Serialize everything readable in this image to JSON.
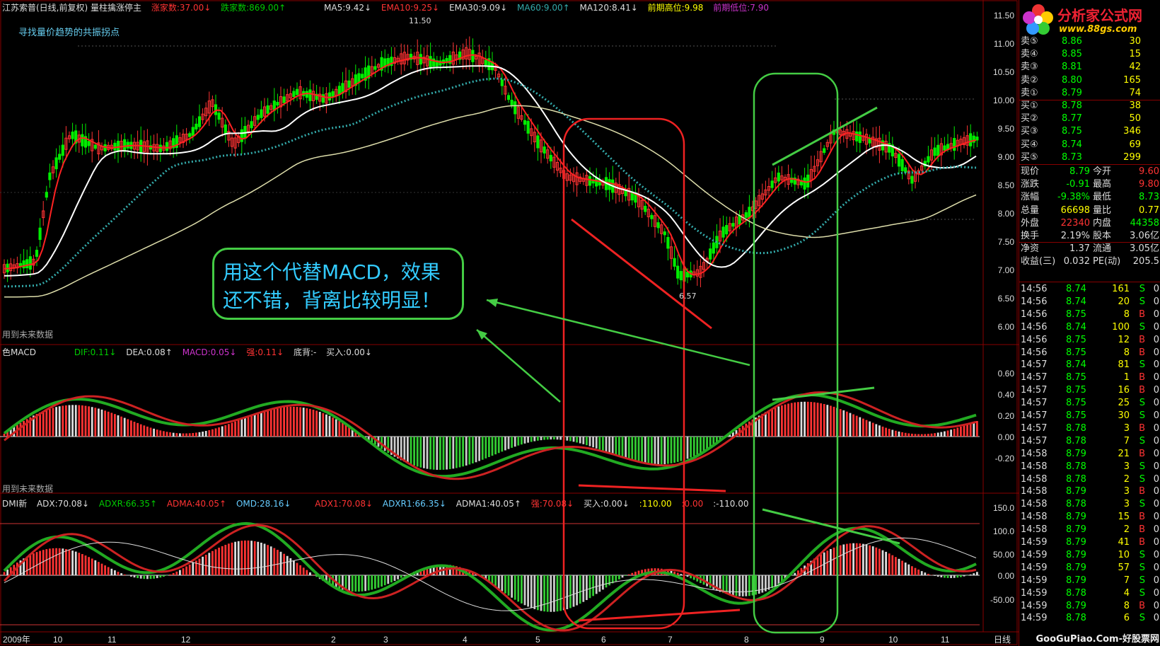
{
  "header": {
    "title": "江苏索普(日线,前复权) 量柱擒涨停主",
    "rise_count": "涨家数:37.00↓",
    "fall_count": "跌家数:869.00↑",
    "ma5": "MA5:9.42↓",
    "ema10": "EMA10:9.25↓",
    "ema30": "EMA30:9.09↓",
    "ma60": "MA60:9.00↑",
    "ma120": "MA120:8.41↓",
    "prev_high": "前期高位:9.98",
    "prev_low": "前期低位:7.90",
    "subtitle": "寻找量价趋势的共振拐点",
    "high_label": "11.50",
    "low_label": "6.57"
  },
  "future_labels": {
    "main": "用到未来数据",
    "macd": "用到未来数据"
  },
  "macd_header": {
    "name": "色MACD",
    "dif": "DIF:0.11↓",
    "dea": "DEA:0.08↑",
    "macd": "MACD:0.05↓",
    "strong": "强:0.11↓",
    "bottom": "底背:-",
    "buy": "买入:0.00↓"
  },
  "dmi_header": {
    "name": "DMI新",
    "adx": "ADX:70.08↓",
    "adxr": "ADXR:66.35↑",
    "adma": "ADMA:40.05↑",
    "omd": "OMD:28.16↓",
    "adx1": "ADX1:70.08↓",
    "adxr1": "ADXR1:66.35↓",
    "adma1": "ADMA1:40.05↑",
    "strong": "强:70.08↓",
    "buy": "买入:0.00↓",
    "v1": ":110.00",
    "v2": ":0.00",
    "v3": ":-110.00"
  },
  "price_axis": [
    "11.50",
    "11.00",
    "10.50",
    "10.00",
    "9.50",
    "9.00",
    "8.50",
    "8.00",
    "7.50",
    "7.00",
    "6.50",
    "6.00"
  ],
  "macd_axis": [
    "0.60",
    "0.40",
    "0.20",
    "0.00",
    "-0.20"
  ],
  "dmi_axis": [
    "150.0",
    "100.0",
    "50.00",
    "0.00",
    "-50.00"
  ],
  "x_axis": [
    "2009年",
    "10",
    "11",
    "12",
    "2",
    "3",
    "4",
    "5",
    "6",
    "7",
    "8",
    "9",
    "10",
    "11",
    "日线"
  ],
  "callout": {
    "line1": "用这个代替MACD，效果",
    "line2": "还不错，背离比较明显！"
  },
  "logo": {
    "brand": "分析家公式网",
    "url": "www.88gs.com"
  },
  "order_book": [
    {
      "label": "卖⑤",
      "price": "8.86",
      "vol": "30"
    },
    {
      "label": "卖④",
      "price": "8.85",
      "vol": "15"
    },
    {
      "label": "卖③",
      "price": "8.81",
      "vol": "42"
    },
    {
      "label": "卖②",
      "price": "8.80",
      "vol": "165"
    },
    {
      "label": "卖①",
      "price": "8.79",
      "vol": "74"
    },
    {
      "label": "买①",
      "price": "8.78",
      "vol": "38"
    },
    {
      "label": "买②",
      "price": "8.77",
      "vol": "50"
    },
    {
      "label": "买③",
      "price": "8.75",
      "vol": "346"
    },
    {
      "label": "买④",
      "price": "8.74",
      "vol": "69"
    },
    {
      "label": "买⑤",
      "price": "8.73",
      "vol": "299"
    }
  ],
  "quote": [
    {
      "l1": "现价",
      "v1": "8.79",
      "l2": "今开",
      "v2": "9.60"
    },
    {
      "l1": "涨跌",
      "v1": "-0.91",
      "l2": "最高",
      "v2": "9.80"
    },
    {
      "l1": "涨幅",
      "v1": "-9.38%",
      "l2": "最低",
      "v2": "8.73"
    },
    {
      "l1": "总量",
      "v1": "66698",
      "l2": "量比",
      "v2": "0.77"
    },
    {
      "l1": "外盘",
      "v1": "22340",
      "l2": "内盘",
      "v2": "44358"
    },
    {
      "l1": "换手",
      "v1": "2.19%",
      "l2": "股本",
      "v2": "3.06亿"
    },
    {
      "l1": "净资",
      "v1": "1.37",
      "l2": "流通",
      "v2": "3.05亿"
    },
    {
      "l1": "收益(三)",
      "v1": "0.032",
      "l2": "PE(动)",
      "v2": "205.5"
    }
  ],
  "ticks": [
    {
      "t": "14:56",
      "p": "8.74",
      "v": "161",
      "s": "S",
      "z": "0"
    },
    {
      "t": "14:56",
      "p": "8.74",
      "v": "20",
      "s": "S",
      "z": "0"
    },
    {
      "t": "14:56",
      "p": "8.75",
      "v": "8",
      "s": "B",
      "z": "0"
    },
    {
      "t": "14:56",
      "p": "8.74",
      "v": "100",
      "s": "S",
      "z": "0"
    },
    {
      "t": "14:56",
      "p": "8.75",
      "v": "12",
      "s": "B",
      "z": "0"
    },
    {
      "t": "14:56",
      "p": "8.75",
      "v": "8",
      "s": "B",
      "z": "0"
    },
    {
      "t": "14:57",
      "p": "8.74",
      "v": "81",
      "s": "S",
      "z": "0"
    },
    {
      "t": "14:57",
      "p": "8.75",
      "v": "1",
      "s": "B",
      "z": "0"
    },
    {
      "t": "14:57",
      "p": "8.75",
      "v": "16",
      "s": "B",
      "z": "0"
    },
    {
      "t": "14:57",
      "p": "8.75",
      "v": "25",
      "s": "S",
      "z": "0"
    },
    {
      "t": "14:57",
      "p": "8.75",
      "v": "30",
      "s": "S",
      "z": "0"
    },
    {
      "t": "14:57",
      "p": "8.78",
      "v": "3",
      "s": "B",
      "z": "0"
    },
    {
      "t": "14:57",
      "p": "8.78",
      "v": "7",
      "s": "S",
      "z": "0"
    },
    {
      "t": "14:58",
      "p": "8.79",
      "v": "21",
      "s": "B",
      "z": "0"
    },
    {
      "t": "14:58",
      "p": "8.78",
      "v": "3",
      "s": "S",
      "z": "0"
    },
    {
      "t": "14:58",
      "p": "8.78",
      "v": "2",
      "s": "S",
      "z": "0"
    },
    {
      "t": "14:58",
      "p": "8.79",
      "v": "3",
      "s": "B",
      "z": "0"
    },
    {
      "t": "14:58",
      "p": "8.78",
      "v": "3",
      "s": "S",
      "z": "0"
    },
    {
      "t": "14:58",
      "p": "8.79",
      "v": "15",
      "s": "B",
      "z": "0"
    },
    {
      "t": "14:58",
      "p": "8.79",
      "v": "2",
      "s": "B",
      "z": "0"
    },
    {
      "t": "14:59",
      "p": "8.79",
      "v": "41",
      "s": "B",
      "z": "0"
    },
    {
      "t": "14:59",
      "p": "8.79",
      "v": "10",
      "s": "S",
      "z": "0"
    },
    {
      "t": "14:59",
      "p": "8.79",
      "v": "57",
      "s": "S",
      "z": "0"
    },
    {
      "t": "14:59",
      "p": "8.79",
      "v": "7",
      "s": "S",
      "z": "0"
    },
    {
      "t": "14:59",
      "p": "8.78",
      "v": "4",
      "s": "S",
      "z": "0"
    },
    {
      "t": "14:59",
      "p": "8.79",
      "v": "8",
      "s": "B",
      "z": "0"
    },
    {
      "t": "14:59",
      "p": "8.78",
      "v": "6",
      "s": "S",
      "z": "0"
    }
  ],
  "watermark": "GooGuPiao.Com-好股票网",
  "colors": {
    "up": "#ff3333",
    "down": "#00ff00",
    "bg": "#000000",
    "grid": "#880000",
    "accent_yellow": "#ffff00",
    "callout_border": "#44cc44",
    "callout_text": "#33ccff"
  }
}
